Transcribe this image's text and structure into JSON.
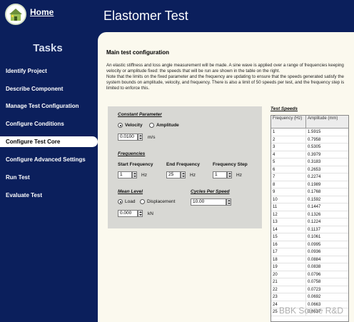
{
  "header": {
    "home_label": "Home",
    "title": "Elastomer Test",
    "logo_icon": "house-logo-icon"
  },
  "sidebar": {
    "title": "Tasks",
    "items": [
      {
        "label": "Identify Project",
        "active": false
      },
      {
        "label": "Describe Component",
        "active": false
      },
      {
        "label": "Manage Test Configuration",
        "active": false
      },
      {
        "label": "Configure Conditions",
        "active": false
      },
      {
        "label": "Configure Test Core",
        "active": true
      },
      {
        "label": "Configure Advanced Settings",
        "active": false
      },
      {
        "label": "Run Test",
        "active": false
      },
      {
        "label": "Evaluate Test",
        "active": false
      }
    ]
  },
  "main": {
    "title": "Main test configuration",
    "description": "An elastic stiffness and loss angle measurement will be made. A sine wave is applied over a range of frequencies keeping velocity or amplitude fixed: the speeds that will be run are shown in the table on the right.\nNote that the limits on the fixed parameter and the frequency are updating to ensure that the speeds generated satisfy the system bounds on amplitude, velocity, and frequency. There is also a limit of 50 speeds per test, and the frequency step is limited to enforce this.",
    "constant_parameter": {
      "title": "Constant Parameter",
      "options": [
        "Velocity",
        "Amplitude"
      ],
      "selected": "Velocity",
      "value": "0.0100",
      "unit": "m/s"
    },
    "frequencies": {
      "title": "Frequencies",
      "start_label": "Start Frequency",
      "start_value": "1",
      "start_unit": "Hz",
      "end_label": "End Frequency",
      "end_value": "25",
      "end_unit": "Hz",
      "step_label": "Frequency Step",
      "step_value": "1",
      "step_unit": "Hz"
    },
    "mean_level": {
      "title": "Mean Level",
      "options": [
        "Load",
        "Displacement"
      ],
      "selected": "Load",
      "value": "0.000",
      "unit": "kN"
    },
    "cycles_per_speed": {
      "title": "Cycles Per Speed",
      "value": "10.00"
    },
    "test_speeds": {
      "title": "Test Speeds",
      "col1_header": "Frequency (Hz)",
      "col2_header": "Amplitude (mm)",
      "rows": [
        [
          "1",
          "1.5915"
        ],
        [
          "2",
          "0.7958"
        ],
        [
          "3",
          "0.5305"
        ],
        [
          "4",
          "0.3979"
        ],
        [
          "5",
          "0.3183"
        ],
        [
          "6",
          "0.2653"
        ],
        [
          "7",
          "0.2274"
        ],
        [
          "8",
          "0.1989"
        ],
        [
          "9",
          "0.1768"
        ],
        [
          "10",
          "0.1592"
        ],
        [
          "11",
          "0.1447"
        ],
        [
          "12",
          "0.1326"
        ],
        [
          "13",
          "0.1224"
        ],
        [
          "14",
          "0.1137"
        ],
        [
          "15",
          "0.1061"
        ],
        [
          "16",
          "0.0995"
        ],
        [
          "17",
          "0.0936"
        ],
        [
          "18",
          "0.0884"
        ],
        [
          "19",
          "0.0838"
        ],
        [
          "20",
          "0.0796"
        ],
        [
          "21",
          "0.0758"
        ],
        [
          "22",
          "0.0723"
        ],
        [
          "23",
          "0.0692"
        ],
        [
          "24",
          "0.0663"
        ],
        [
          "25",
          "0.0637"
        ]
      ]
    },
    "watermark": "BBK Scene R&D"
  }
}
